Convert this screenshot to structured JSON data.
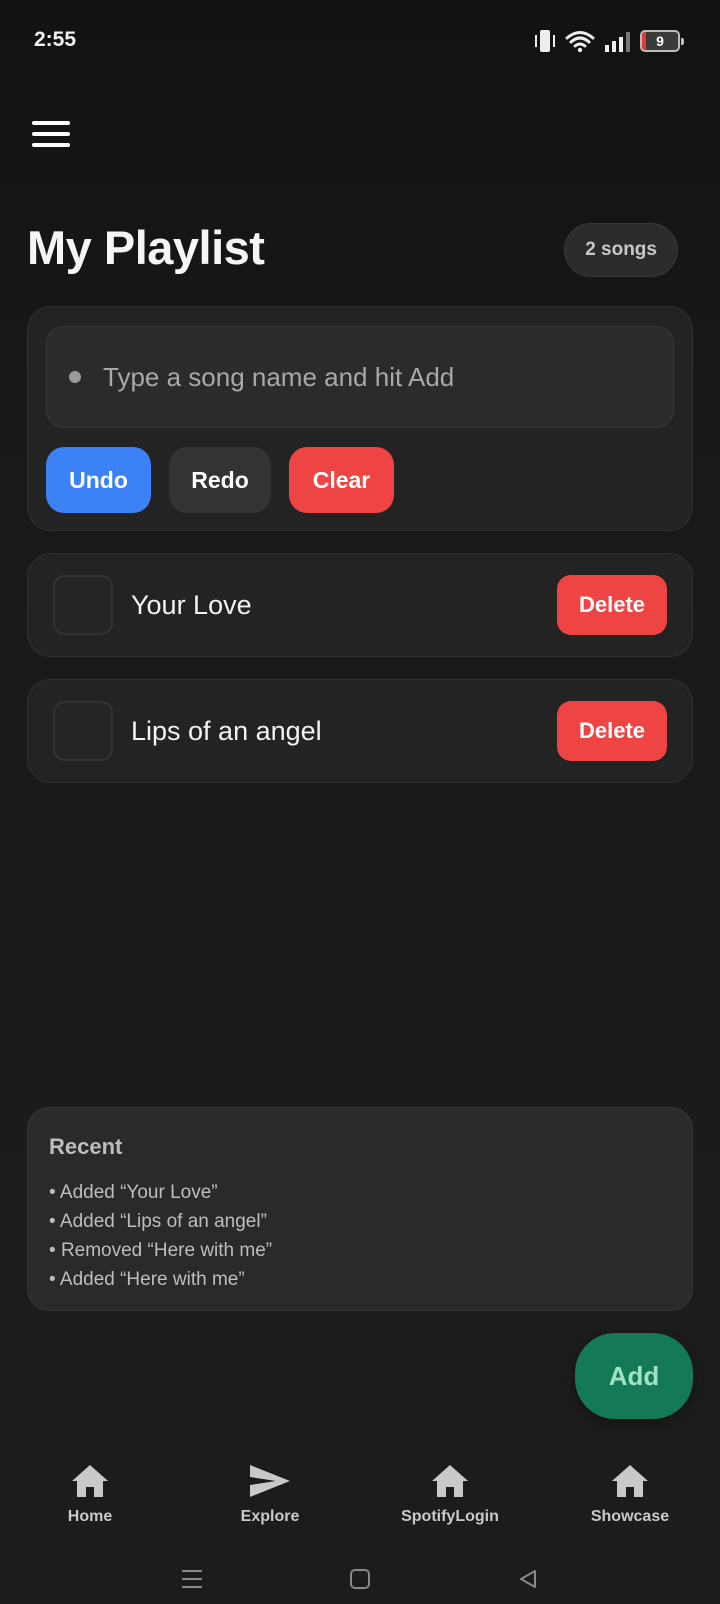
{
  "status_bar": {
    "time": "2:55",
    "battery_level": "9"
  },
  "header": {
    "title": "My Playlist",
    "song_count": "2 songs"
  },
  "input": {
    "placeholder": "Type a song name and hit Add",
    "value": ""
  },
  "actions": {
    "undo": "Undo",
    "redo": "Redo",
    "clear": "Clear"
  },
  "songs": [
    {
      "title": "Your Love",
      "delete_label": "Delete",
      "checked": false
    },
    {
      "title": "Lips of an angel",
      "delete_label": "Delete",
      "checked": false
    }
  ],
  "recent": {
    "title": "Recent",
    "items": [
      "Added “Your Love”",
      "Added “Lips of an angel”",
      "Removed “Here with me”",
      "Added “Here with me”"
    ]
  },
  "fab": {
    "label": "Add"
  },
  "bottom_nav": [
    {
      "label": "Home",
      "icon": "home-icon"
    },
    {
      "label": "Explore",
      "icon": "send-icon"
    },
    {
      "label": "SpotifyLogin",
      "icon": "home-icon"
    },
    {
      "label": "Showcase",
      "icon": "home-icon"
    }
  ],
  "system_nav": {
    "icons": [
      "recents-icon",
      "home-square-icon",
      "back-triangle-icon"
    ]
  },
  "colors": {
    "background": "#1b1b1b",
    "undo": "#3b82f6",
    "danger": "#ef4444",
    "fab": "#137a55",
    "battery_low": "#e53935"
  }
}
